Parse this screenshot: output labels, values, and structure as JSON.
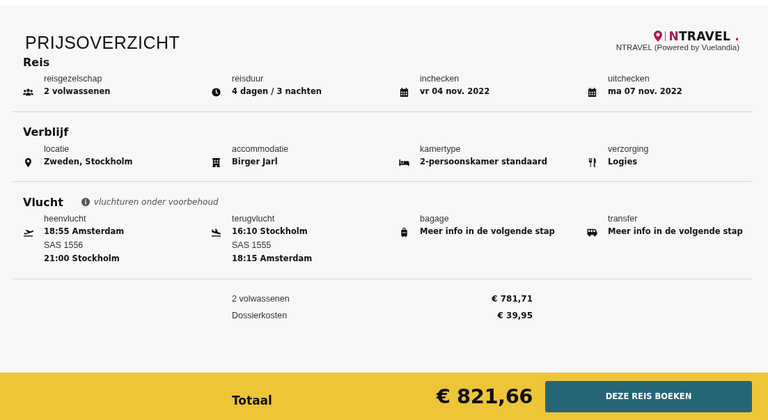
{
  "title": "PRIJSOVERZICHT",
  "brand": {
    "name": "NTRAVEL",
    "dot": ".",
    "subtitle": "NTRAVEL (Powered by Vuelandia)"
  },
  "sections": [
    {
      "title": "Reis",
      "items": [
        {
          "label": "reisgezelschap",
          "kind": "group",
          "lines": [
            {
              "text": "2 volwassenen",
              "strong": true
            }
          ]
        },
        {
          "label": "reisduur",
          "kind": "clock",
          "lines": [
            {
              "text": "4 dagen / 3 nachten",
              "strong": true
            }
          ]
        },
        {
          "label": "inchecken",
          "kind": "calendar",
          "lines": [
            {
              "text": "vr 04 nov. 2022",
              "strong": true
            }
          ]
        },
        {
          "label": "uitchecken",
          "kind": "calendar",
          "lines": [
            {
              "text": "ma 07 nov. 2022",
              "strong": true
            }
          ]
        }
      ]
    },
    {
      "title": "Verblijf",
      "items": [
        {
          "label": "locatie",
          "kind": "pin",
          "lines": [
            {
              "text": "Zweden, Stockholm",
              "strong": true
            }
          ]
        },
        {
          "label": "accommodatie",
          "kind": "building",
          "lines": [
            {
              "text": "Birger Jarl",
              "strong": true
            }
          ]
        },
        {
          "label": "kamertype",
          "kind": "bed",
          "lines": [
            {
              "text": "2-persoonskamer standaard",
              "strong": true
            }
          ]
        },
        {
          "label": "verzorging",
          "kind": "cutlery",
          "lines": [
            {
              "text": "Logies",
              "strong": true
            }
          ]
        }
      ]
    },
    {
      "title": "Vlucht",
      "note": "vluchturen onder voorbehoud",
      "items": [
        {
          "label": "heenvlucht",
          "kind": "departure",
          "lines": [
            {
              "text": "18:55 Amsterdam",
              "strong": true
            },
            {
              "text": "SAS 1556",
              "strong": false
            },
            {
              "text": "21:00 Stockholm",
              "strong": true
            }
          ]
        },
        {
          "label": "terugvlucht",
          "kind": "arrival",
          "lines": [
            {
              "text": "16:10 Stockholm",
              "strong": true
            },
            {
              "text": "SAS 1555",
              "strong": false
            },
            {
              "text": "18:15 Amsterdam",
              "strong": true
            }
          ]
        },
        {
          "label": "bagage",
          "kind": "luggage",
          "lines": [
            {
              "text": "Meer info in de volgende stap",
              "strong": true
            }
          ]
        },
        {
          "label": "transfer",
          "kind": "van",
          "lines": [
            {
              "text": "Meer info in de volgende stap",
              "strong": true
            }
          ]
        }
      ]
    }
  ],
  "prices": [
    {
      "label": "2 volwassenen",
      "amount": "€ 781,71"
    },
    {
      "label": "Dossierkosten",
      "amount": "€ 39,95"
    }
  ],
  "total": {
    "label": "Totaal",
    "amount": "€ 821,66",
    "button": "DEZE REIS BOEKEN"
  }
}
